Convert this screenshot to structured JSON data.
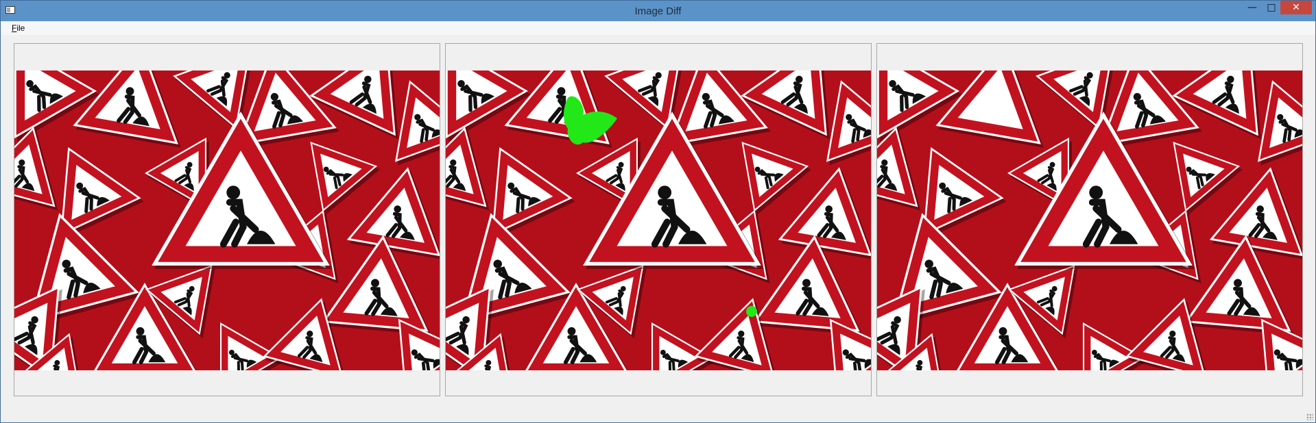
{
  "window": {
    "title": "Image Diff",
    "controls": {
      "minimize": "—",
      "maximize": "□",
      "close": "✕"
    }
  },
  "menu": {
    "items": [
      {
        "mnemonic": "F",
        "rest": "ile"
      }
    ]
  },
  "panes": [
    {
      "name": "original",
      "highlights": []
    },
    {
      "name": "diff",
      "highlights": [
        "green"
      ]
    },
    {
      "name": "modified",
      "highlights": []
    }
  ],
  "colors": {
    "sign_red": "#c2121f",
    "sign_white": "#ffffff",
    "symbol_black": "#111111",
    "diff_highlight": "#22e818",
    "titlebar": "#5b93c8"
  },
  "icons": [
    "app-icon",
    "minimize-icon",
    "maximize-icon",
    "close-icon",
    "resize-grip-icon"
  ]
}
